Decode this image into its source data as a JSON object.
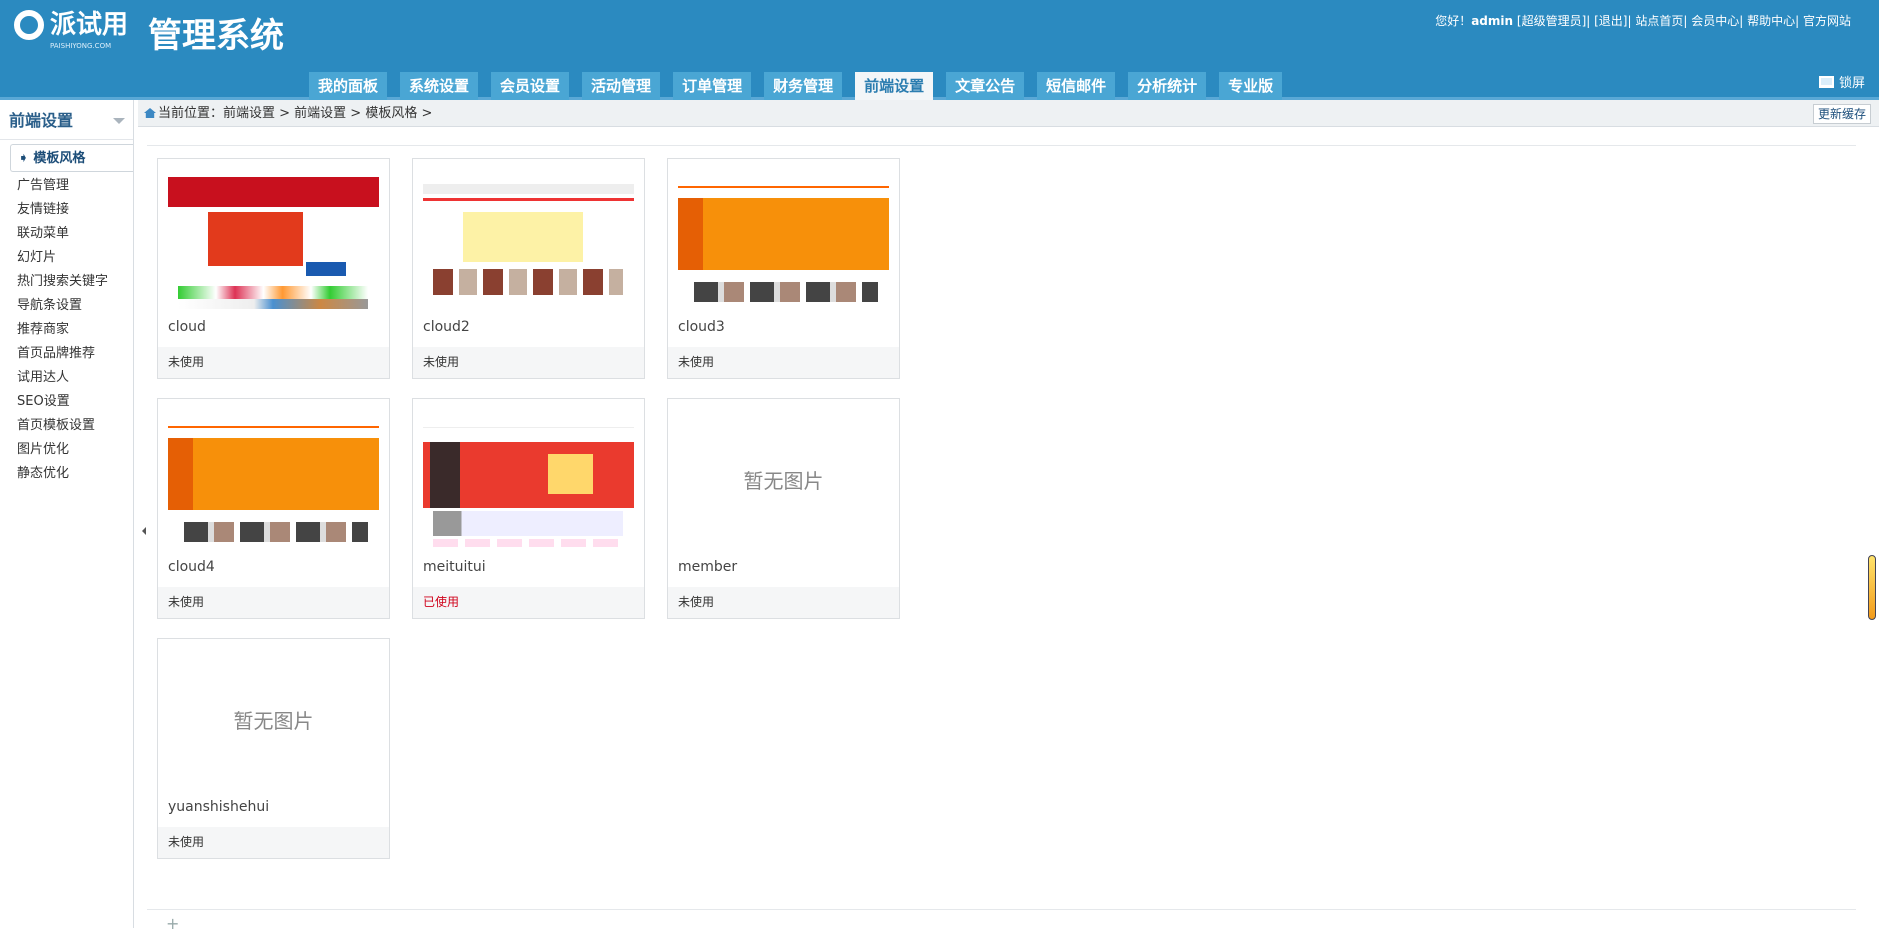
{
  "header": {
    "brand": "派试用",
    "brand_sub": "PAISHIYONG.COM",
    "title": "管理系统",
    "greeting": "您好！",
    "user": "admin",
    "role": "[超级管理员]",
    "logout": "[退出]",
    "links": [
      "站点首页",
      "会员中心",
      "帮助中心",
      "官方网站"
    ],
    "lock": "锁屏"
  },
  "tabs": [
    {
      "label": "我的面板"
    },
    {
      "label": "系统设置"
    },
    {
      "label": "会员设置"
    },
    {
      "label": "活动管理"
    },
    {
      "label": "订单管理"
    },
    {
      "label": "财务管理"
    },
    {
      "label": "前端设置",
      "active": true
    },
    {
      "label": "文章公告"
    },
    {
      "label": "短信邮件"
    },
    {
      "label": "分析统计"
    },
    {
      "label": "专业版"
    }
  ],
  "sidebar": {
    "title": "前端设置",
    "active": "➧ 模板风格",
    "items": [
      "广告管理",
      "友情链接",
      "联动菜单",
      "幻灯片",
      "热门搜索关键字",
      "导航条设置",
      "推荐商家",
      "首页品牌推荐",
      "试用达人",
      "SEO设置",
      "首页模板设置",
      "图片优化",
      "静态优化"
    ]
  },
  "breadcrumb": {
    "text": "当前位置：前端设置 > 前端设置 > 模板风格 >",
    "refresh": "更新缓存"
  },
  "no_image": "暂无图片",
  "templates": [
    {
      "name": "cloud",
      "status": "未使用",
      "theme": "red"
    },
    {
      "name": "cloud2",
      "status": "未使用",
      "theme": "light"
    },
    {
      "name": "cloud3",
      "status": "未使用",
      "theme": "orange"
    },
    {
      "name": "cloud4",
      "status": "未使用",
      "theme": "orange"
    },
    {
      "name": "meituitui",
      "status": "已使用",
      "theme": "meitui"
    },
    {
      "name": "member",
      "status": "未使用",
      "theme": "none"
    },
    {
      "name": "yuanshishehui",
      "status": "未使用",
      "theme": "none"
    }
  ],
  "colors": {
    "header": "#2b8ac0",
    "used": "#d0021b"
  }
}
